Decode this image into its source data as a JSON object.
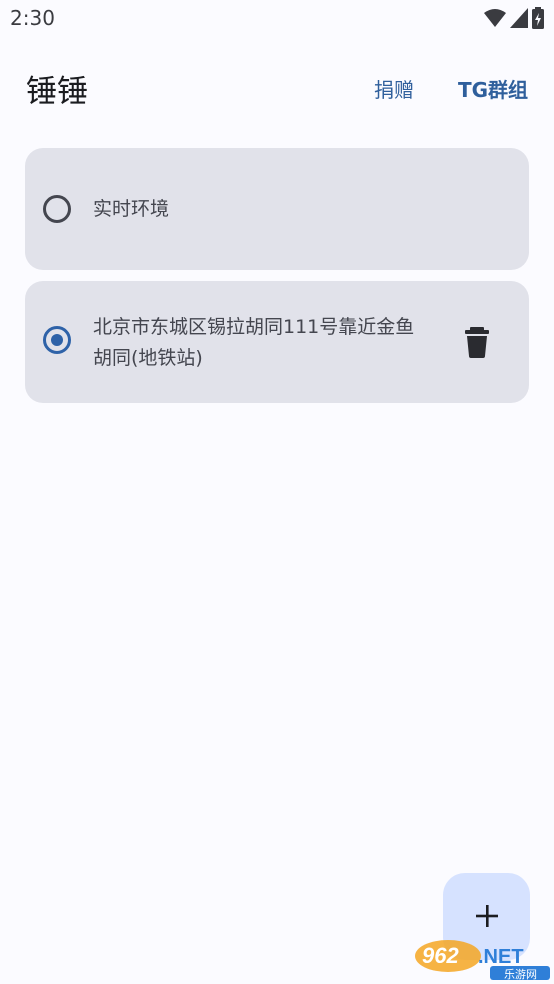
{
  "status_bar": {
    "time": "2:30",
    "icons": [
      "wifi-icon",
      "signal-icon",
      "battery-charging-icon"
    ]
  },
  "app_bar": {
    "title": "锤锤",
    "actions": [
      "捐赠",
      "TG群组"
    ]
  },
  "locations": [
    {
      "label": "实时环境",
      "selected": false
    },
    {
      "label": "北京市东城区锡拉胡同111号靠近金鱼胡同(地铁站)",
      "selected": true,
      "action_icon": "trash-icon"
    }
  ],
  "fab": {
    "icon": "plus-icon"
  },
  "watermark": {
    "text": "962.NET",
    "subtext": "乐游网"
  },
  "colors": {
    "background": "#fbfbff",
    "card": "#e1e2ea",
    "accent": "#2e62a8",
    "fab": "#d6e2ff"
  }
}
